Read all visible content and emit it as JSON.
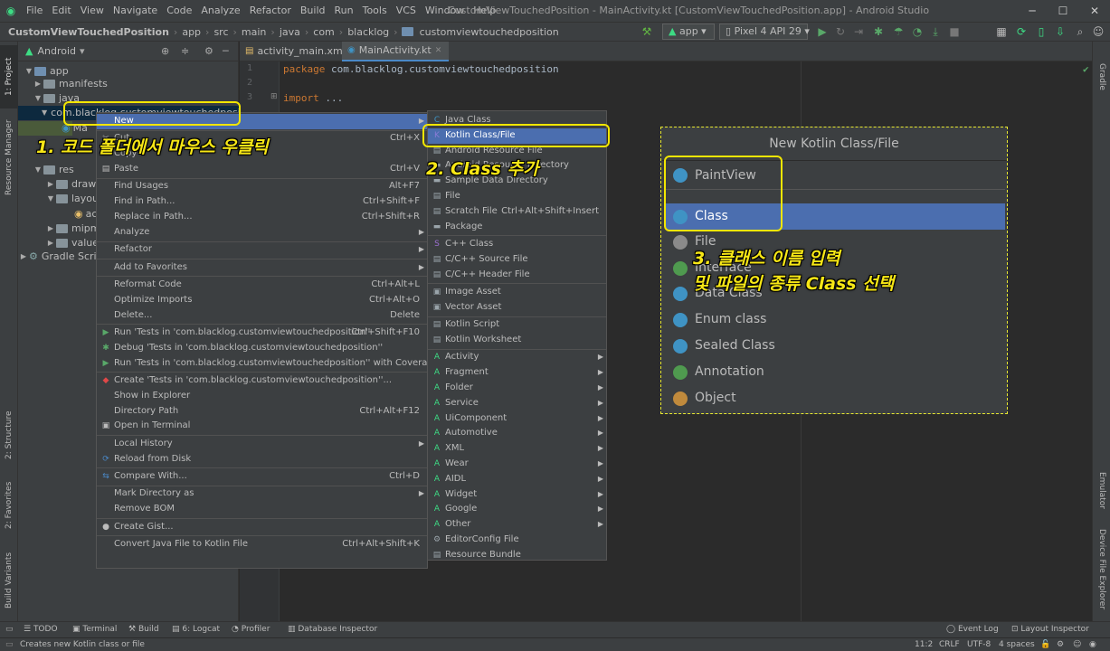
{
  "window": {
    "menu": [
      "File",
      "Edit",
      "View",
      "Navigate",
      "Code",
      "Analyze",
      "Refactor",
      "Build",
      "Run",
      "Tools",
      "VCS",
      "Window",
      "Help"
    ],
    "title": "CustomViewTouchedPosition - MainActivity.kt [CustomViewTouchedPosition.app] - Android Studio"
  },
  "navbar": {
    "crumbs": [
      "CustomViewTouchedPosition",
      "app",
      "src",
      "main",
      "java",
      "com",
      "blacklog",
      "customviewtouchedposition"
    ],
    "run_config": "app",
    "device": "Pixel 4 API 29"
  },
  "left_tabs": [
    "1: Project",
    "Resource Manager",
    "2: Structure",
    "2: Favorites",
    "Build Variants"
  ],
  "right_tabs": [
    "Gradle",
    "Emulator",
    "Device File Explorer"
  ],
  "project": {
    "view_label": "Android",
    "tree": [
      {
        "label": "app",
        "tri": "▼"
      },
      {
        "label": "manifests",
        "tri": "▶"
      },
      {
        "label": "java",
        "tri": "▼"
      },
      {
        "label": "com.blacklog.customviewtouchedposition",
        "tri": "▼"
      },
      {
        "label": "Ma",
        "tri": ""
      },
      {
        "label": "res",
        "tri": "▼"
      },
      {
        "label": "drawa",
        "tri": "▶"
      },
      {
        "label": "layou",
        "tri": "▼"
      },
      {
        "label": "act",
        "tri": ""
      },
      {
        "label": "mipma",
        "tri": "▶"
      },
      {
        "label": "values",
        "tri": "▶"
      },
      {
        "label": "Gradle Script",
        "tri": "▶"
      }
    ]
  },
  "editor": {
    "tabs": [
      "activity_main.xml",
      "MainActivity.kt"
    ],
    "lines": [
      {
        "num": "1",
        "kw": "package",
        "rest": " com.blacklog.customviewtouchedposition"
      },
      {
        "num": "2",
        "kw": "",
        "rest": ""
      },
      {
        "num": "3",
        "kw": "import",
        "rest": " ..."
      }
    ]
  },
  "context_menu": [
    {
      "label": "New",
      "shortcut": "",
      "arrow": true,
      "icon": ""
    },
    {
      "sep": true
    },
    {
      "label": "Cut",
      "shortcut": "Ctrl+X",
      "icon": "✂"
    },
    {
      "label": "Copy",
      "shortcut": "",
      "icon": ""
    },
    {
      "label": "Paste",
      "shortcut": "Ctrl+V",
      "icon": "▤"
    },
    {
      "sep": true
    },
    {
      "label": "Find Usages",
      "shortcut": "Alt+F7",
      "icon": ""
    },
    {
      "label": "Find in Path...",
      "shortcut": "Ctrl+Shift+F",
      "icon": ""
    },
    {
      "label": "Replace in Path...",
      "shortcut": "Ctrl+Shift+R",
      "icon": ""
    },
    {
      "label": "Analyze",
      "shortcut": "",
      "arrow": true,
      "icon": ""
    },
    {
      "sep": true
    },
    {
      "label": "Refactor",
      "shortcut": "",
      "arrow": true,
      "icon": ""
    },
    {
      "sep": true
    },
    {
      "label": "Add to Favorites",
      "shortcut": "",
      "arrow": true,
      "icon": ""
    },
    {
      "sep": true
    },
    {
      "label": "Reformat Code",
      "shortcut": "Ctrl+Alt+L",
      "icon": ""
    },
    {
      "label": "Optimize Imports",
      "shortcut": "Ctrl+Alt+O",
      "icon": ""
    },
    {
      "label": "Delete...",
      "shortcut": "Delete",
      "icon": ""
    },
    {
      "sep": true
    },
    {
      "label": "Run 'Tests in 'com.blacklog.customviewtouchedposition''",
      "shortcut": "Ctrl+Shift+F10",
      "icon": "▶"
    },
    {
      "label": "Debug 'Tests in 'com.blacklog.customviewtouchedposition''",
      "shortcut": "",
      "icon": "✱"
    },
    {
      "label": "Run 'Tests in 'com.blacklog.customviewtouchedposition'' with Coverage",
      "shortcut": "",
      "icon": "▶"
    },
    {
      "sep": true
    },
    {
      "label": "Create 'Tests in 'com.blacklog.customviewtouchedposition''...",
      "shortcut": "",
      "icon": "◆"
    },
    {
      "label": "Show in Explorer",
      "shortcut": "",
      "icon": ""
    },
    {
      "label": "Directory Path",
      "shortcut": "Ctrl+Alt+F12",
      "icon": ""
    },
    {
      "label": "Open in Terminal",
      "shortcut": "",
      "icon": "▣"
    },
    {
      "sep": true
    },
    {
      "label": "Local History",
      "shortcut": "",
      "arrow": true,
      "icon": ""
    },
    {
      "label": "Reload from Disk",
      "shortcut": "",
      "icon": "⟳"
    },
    {
      "sep": true
    },
    {
      "label": "Compare With...",
      "shortcut": "Ctrl+D",
      "icon": "⇆"
    },
    {
      "sep": true
    },
    {
      "label": "Mark Directory as",
      "shortcut": "",
      "arrow": true,
      "icon": ""
    },
    {
      "label": "Remove BOM",
      "shortcut": "",
      "icon": ""
    },
    {
      "sep": true
    },
    {
      "label": "Create Gist...",
      "shortcut": "",
      "icon": "●"
    },
    {
      "sep": true
    },
    {
      "label": "Convert Java File to Kotlin File",
      "shortcut": "Ctrl+Alt+Shift+K",
      "icon": ""
    }
  ],
  "new_submenu": [
    {
      "label": "Java Class",
      "shortcut": "",
      "icon": "C"
    },
    {
      "label": "Kotlin Class/File",
      "shortcut": "",
      "icon": "K"
    },
    {
      "label": "Android Resource File",
      "shortcut": "",
      "icon": "▤"
    },
    {
      "label": "Android Resource Directory",
      "shortcut": "",
      "icon": "▬"
    },
    {
      "label": "Sample Data Directory",
      "shortcut": "",
      "icon": "▬"
    },
    {
      "label": "File",
      "shortcut": "",
      "icon": "▤"
    },
    {
      "label": "Scratch File",
      "shortcut": "Ctrl+Alt+Shift+Insert",
      "icon": "▤"
    },
    {
      "label": "Package",
      "shortcut": "",
      "icon": "▬"
    },
    {
      "sep": true
    },
    {
      "label": "C++ Class",
      "shortcut": "",
      "icon": "S"
    },
    {
      "label": "C/C++ Source File",
      "shortcut": "",
      "icon": "▤"
    },
    {
      "label": "C/C++ Header File",
      "shortcut": "",
      "icon": "▤"
    },
    {
      "sep": true
    },
    {
      "label": "Image Asset",
      "shortcut": "",
      "icon": "▣"
    },
    {
      "label": "Vector Asset",
      "shortcut": "",
      "icon": "▣"
    },
    {
      "sep": true
    },
    {
      "label": "Kotlin Script",
      "shortcut": "",
      "icon": "▤"
    },
    {
      "label": "Kotlin Worksheet",
      "shortcut": "",
      "icon": "▤"
    },
    {
      "sep": true
    },
    {
      "label": "Activity",
      "arrow": true,
      "icon": "A"
    },
    {
      "label": "Fragment",
      "arrow": true,
      "icon": "A"
    },
    {
      "label": "Folder",
      "arrow": true,
      "icon": "A"
    },
    {
      "label": "Service",
      "arrow": true,
      "icon": "A"
    },
    {
      "label": "UiComponent",
      "arrow": true,
      "icon": "A"
    },
    {
      "label": "Automotive",
      "arrow": true,
      "icon": "A"
    },
    {
      "label": "XML",
      "arrow": true,
      "icon": "A"
    },
    {
      "label": "Wear",
      "arrow": true,
      "icon": "A"
    },
    {
      "label": "AIDL",
      "arrow": true,
      "icon": "A"
    },
    {
      "label": "Widget",
      "arrow": true,
      "icon": "A"
    },
    {
      "label": "Google",
      "arrow": true,
      "icon": "A"
    },
    {
      "label": "Other",
      "arrow": true,
      "icon": "A"
    },
    {
      "label": "EditorConfig File",
      "shortcut": "",
      "icon": "⚙"
    },
    {
      "label": "Resource Bundle",
      "shortcut": "",
      "icon": "▤"
    }
  ],
  "dialog": {
    "title": "New Kotlin Class/File",
    "input_value": "PaintView",
    "items": [
      {
        "label": "Class",
        "color": "#3f93c4"
      },
      {
        "label": "File",
        "color": "#8a8a8a"
      },
      {
        "label": "Interface",
        "color": "#4f9a4f"
      },
      {
        "label": "Data Class",
        "color": "#3f93c4"
      },
      {
        "label": "Enum class",
        "color": "#3f93c4"
      },
      {
        "label": "Sealed Class",
        "color": "#3f93c4"
      },
      {
        "label": "Annotation",
        "color": "#4f9a4f"
      },
      {
        "label": "Object",
        "color": "#c08a3c"
      }
    ]
  },
  "annotations": {
    "step1": "1. 코드 폴더에서 마우스 우클릭",
    "step2": "2. Class 추가",
    "step3_line1": "3. 클래스 이름 입력",
    "step3_line2": "및 파일의 종류 Class 선택",
    "color": "#f7e716"
  },
  "bottom_tools": [
    "TODO",
    "Terminal",
    "Build",
    "6: Logcat",
    "Profiler",
    "Database Inspector",
    "Event Log",
    "Layout Inspector"
  ],
  "status": {
    "message": "Creates new Kotlin class or file",
    "position": "11:2",
    "line_sep": "CRLF",
    "encoding": "UTF-8",
    "indent": "4 spaces"
  }
}
